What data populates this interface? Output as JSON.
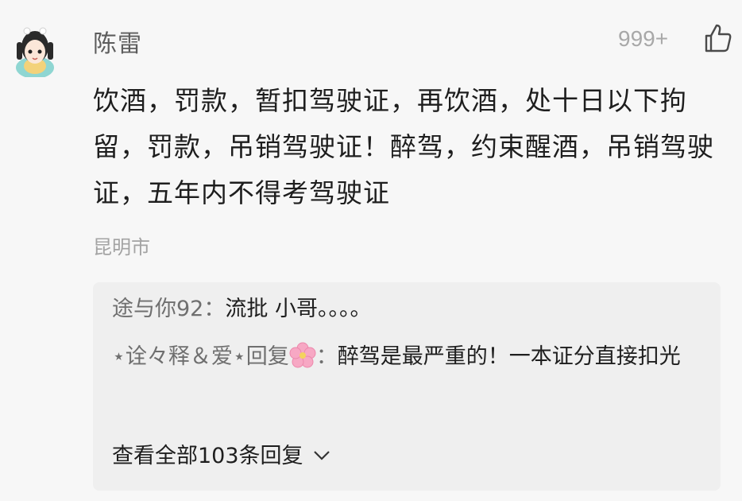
{
  "comment": {
    "username": "陈雷",
    "like_count": "999+",
    "text": "饮酒，罚款，暂扣驾驶证，再饮酒，处十日以下拘留，罚款，吊销驾驶证！醉驾，约束醒酒，吊销驾驶证，五年内不得考驾驶证",
    "location": "昆明市"
  },
  "replies": [
    {
      "author": "途与你92",
      "separator": "：",
      "text": "流批 小哥。。。。"
    },
    {
      "author": "⋆诠々释＆爱⋆回复",
      "separator": "：",
      "text": "醉驾是最严重的！一本证分直接扣光"
    }
  ],
  "view_all_label": "查看全部103条回复",
  "icons": {
    "avatar": "avatar",
    "like": "thumbs-up-icon",
    "flower": "cherry-blossom-icon",
    "chevron": "chevron-down-icon"
  },
  "colors": {
    "background": "#f7f7f7",
    "reply_box": "#efefef",
    "muted_text": "#a8a8a8",
    "main_text": "#1e1e1e"
  }
}
